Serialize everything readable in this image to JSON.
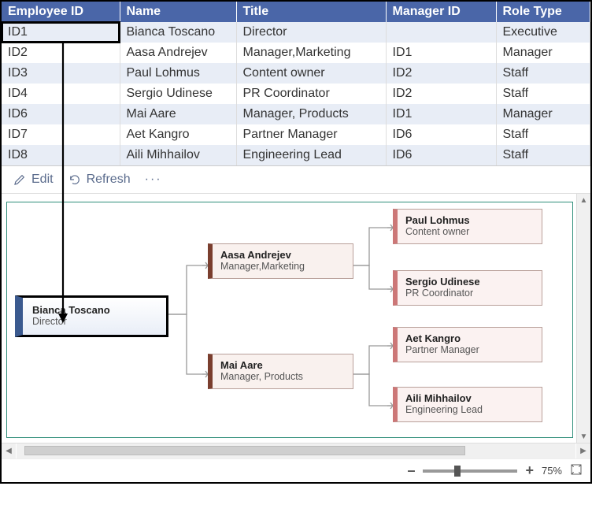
{
  "table": {
    "headers": [
      "Employee ID",
      "Name",
      "Title",
      "Manager ID",
      "Role Type"
    ],
    "rows": [
      {
        "id": "ID1",
        "name": "Bianca Toscano",
        "title": "Director",
        "mgr": "",
        "role": "Executive"
      },
      {
        "id": "ID2",
        "name": "Aasa Andrejev",
        "title": "Manager,Marketing",
        "mgr": "ID1",
        "role": "Manager"
      },
      {
        "id": "ID3",
        "name": "Paul Lohmus",
        "title": "Content owner",
        "mgr": "ID2",
        "role": "Staff"
      },
      {
        "id": "ID4",
        "name": "Sergio Udinese",
        "title": "PR Coordinator",
        "mgr": "ID2",
        "role": "Staff"
      },
      {
        "id": "ID6",
        "name": "Mai Aare",
        "title": "Manager, Products",
        "mgr": "ID1",
        "role": "Manager"
      },
      {
        "id": "ID7",
        "name": "Aet Kangro",
        "title": "Partner Manager",
        "mgr": "ID6",
        "role": "Staff"
      },
      {
        "id": "ID8",
        "name": "Aili Mihhailov",
        "title": "Engineering Lead",
        "mgr": "ID6",
        "role": "Staff"
      }
    ]
  },
  "toolbar": {
    "edit": "Edit",
    "refresh": "Refresh"
  },
  "org": {
    "root": {
      "name": "Bianca Toscano",
      "title": "Director"
    },
    "m1": {
      "name": "Aasa Andrejev",
      "title": "Manager,Marketing"
    },
    "m2": {
      "name": "Mai Aare",
      "title": "Manager, Products"
    },
    "s1": {
      "name": "Paul Lohmus",
      "title": "Content owner"
    },
    "s2": {
      "name": "Sergio Udinese",
      "title": "PR Coordinator"
    },
    "s3": {
      "name": "Aet Kangro",
      "title": "Partner Manager"
    },
    "s4": {
      "name": "Aili Mihhailov",
      "title": "Engineering Lead"
    }
  },
  "zoom": {
    "minus": "–",
    "plus": "+",
    "value": "75%"
  }
}
